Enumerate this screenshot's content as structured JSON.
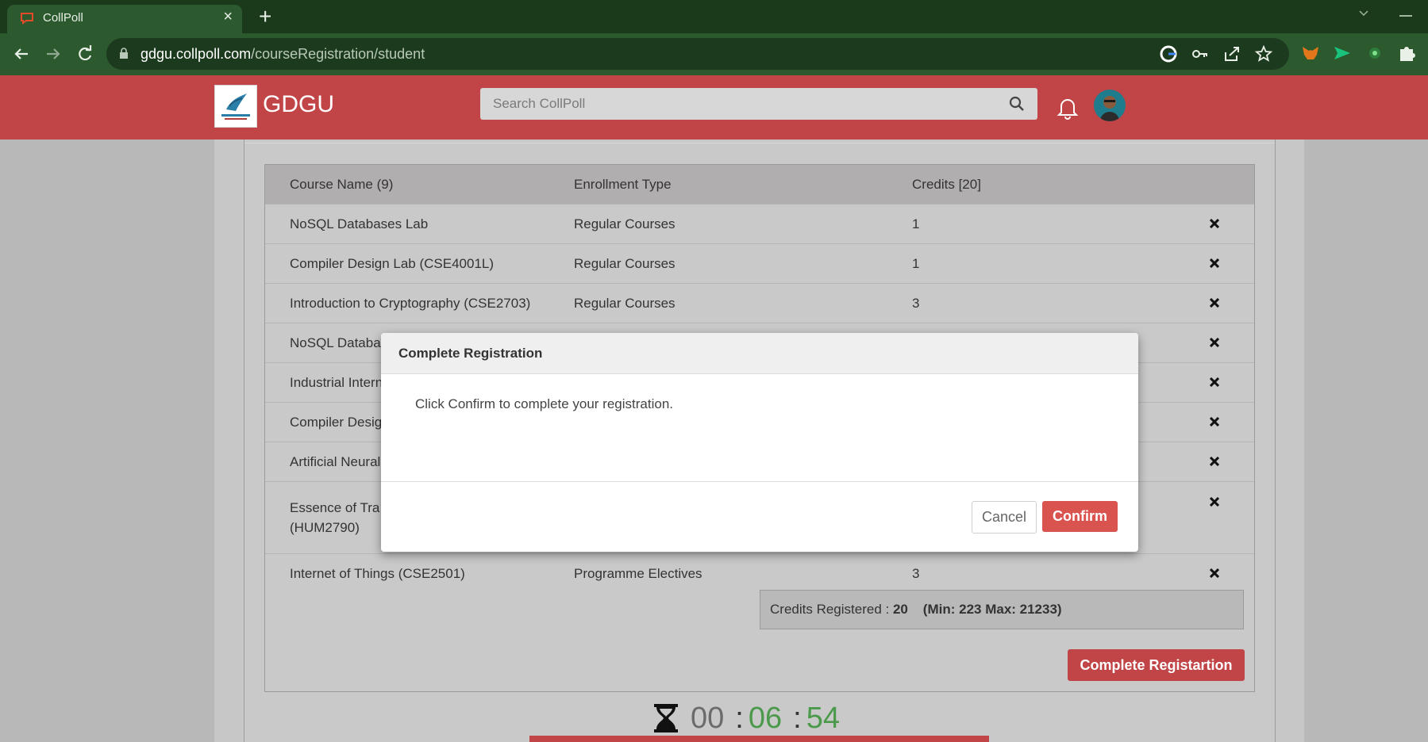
{
  "browser": {
    "tab_title": "CollPoll",
    "new_tab_icon": "plus-icon",
    "url_host": "gdgu.collpoll.com",
    "url_path": "/courseRegistration/student"
  },
  "header": {
    "brand": "GDGU",
    "search_placeholder": "Search CollPoll"
  },
  "table": {
    "headers": [
      "Course Name (9)",
      "Enrollment Type",
      "Credits [20]"
    ],
    "rows": [
      {
        "name": "NoSQL Databases Lab",
        "type": "Regular Courses",
        "credits": "1"
      },
      {
        "name": "Compiler Design Lab (CSE4001L)",
        "type": "Regular Courses",
        "credits": "1"
      },
      {
        "name": "Introduction to Cryptography (CSE2703)",
        "type": "Regular Courses",
        "credits": "3"
      },
      {
        "name": "NoSQL Databa",
        "type": "",
        "credits": ""
      },
      {
        "name": "Industrial Intern",
        "type": "",
        "credits": ""
      },
      {
        "name": "Compiler Desig",
        "type": "",
        "credits": ""
      },
      {
        "name": "Artificial Neural",
        "type": "",
        "credits": ""
      },
      {
        "name_line1": "Essence of Tra",
        "name_line2": "(HUM2790)",
        "type": "",
        "credits": ""
      },
      {
        "name": "Internet of Things (CSE2501)",
        "type": "Programme Electives",
        "credits": "3"
      }
    ]
  },
  "summary": {
    "label": "Credits Registered :",
    "value": "20",
    "range": "(Min: 223 Max: 21233)"
  },
  "complete_button": "Complete Registartion",
  "timer": {
    "hh": "00",
    "sep1": ":",
    "mm": "06",
    "sep2": ":",
    "ss": "54"
  },
  "modal": {
    "title": "Complete Registration",
    "body": "Click Confirm to complete your registration.",
    "cancel": "Cancel",
    "confirm": "Confirm"
  },
  "colors": {
    "brand": "#c14546",
    "confirm": "#d9534f",
    "timer_green": "#4b9a4b",
    "chrome": "#2c5a2e"
  }
}
